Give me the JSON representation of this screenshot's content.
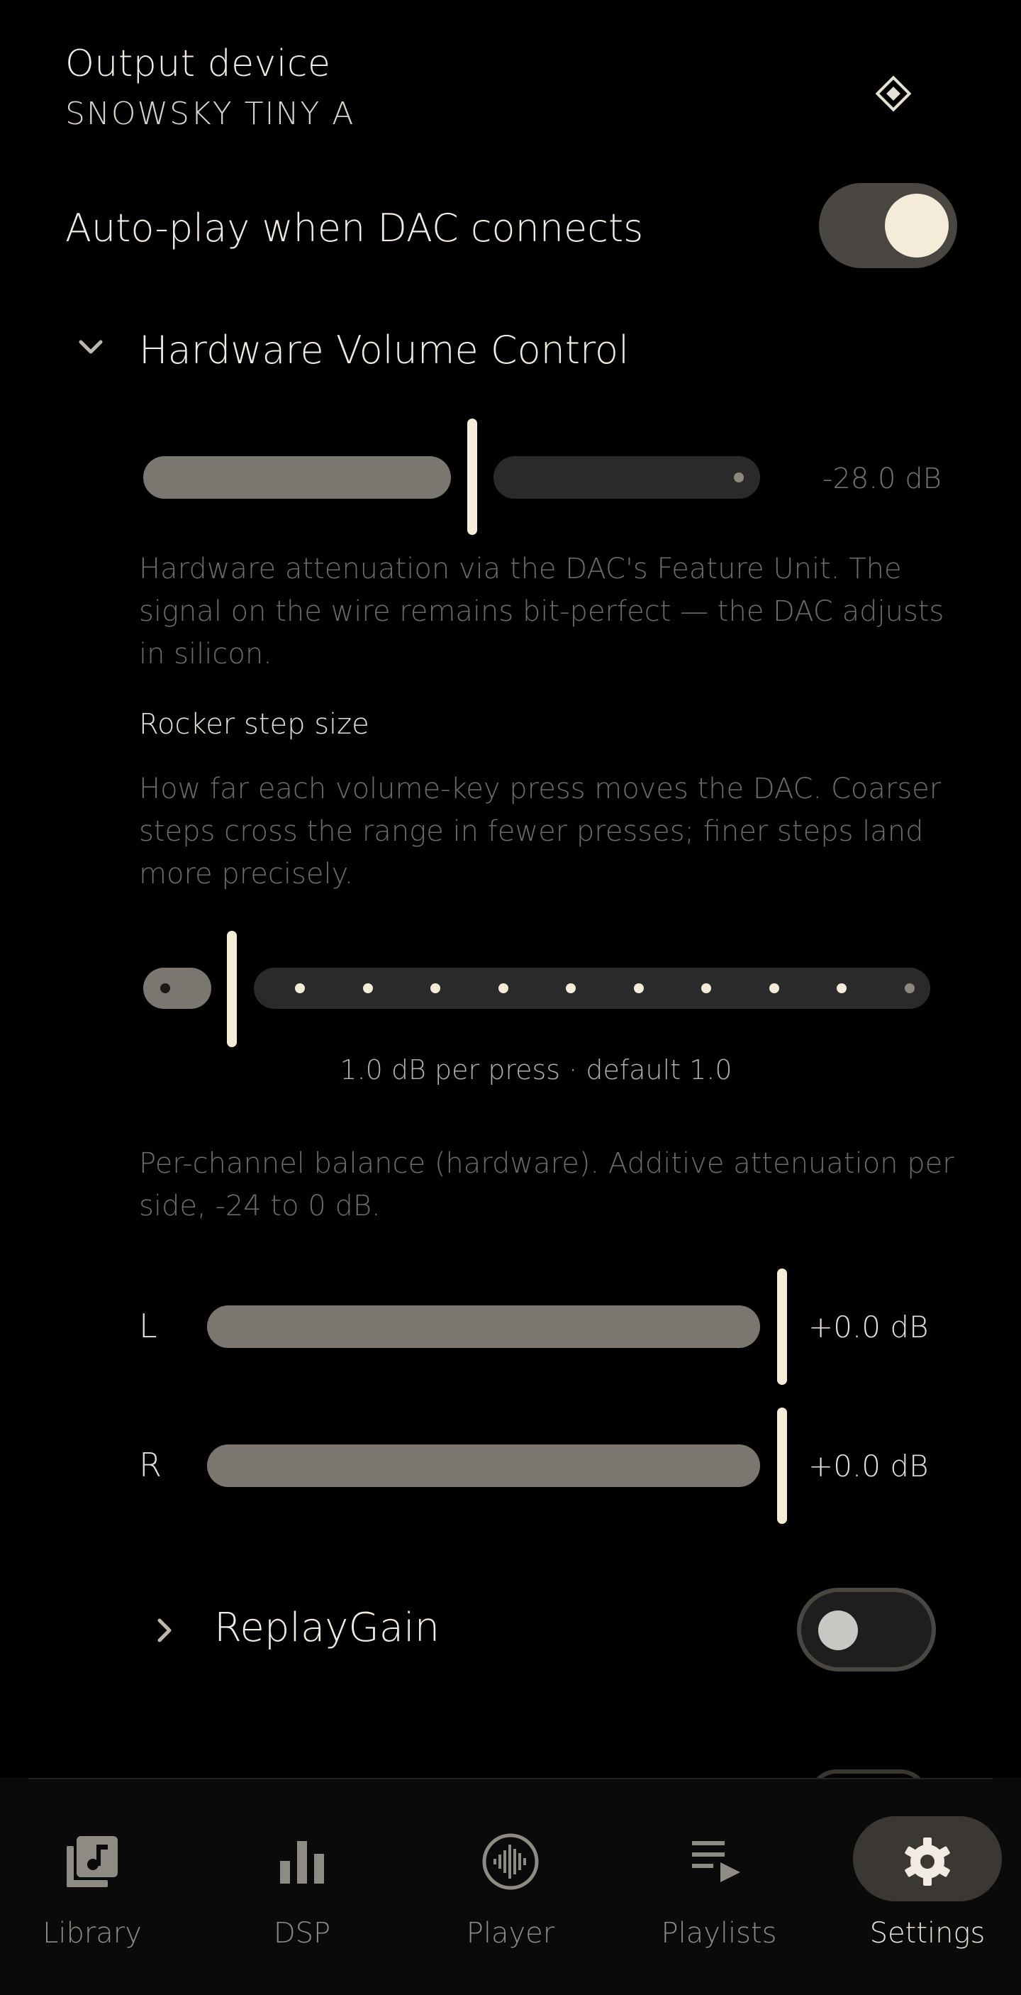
{
  "output_device": {
    "title": "Output device",
    "device_name": "SNOWSKY TINY A",
    "icon": "diamond-icon"
  },
  "auto_play": {
    "label": "Auto-play when DAC connects",
    "enabled": true
  },
  "hardware_volume": {
    "section_title": "Hardware Volume Control",
    "expanded": true,
    "volume_value": "-28.0 dB",
    "volume_fraction": 0.55,
    "description": "Hardware attenuation via the DAC's Feature Unit. The signal on the wire remains bit-perfect — the DAC adjusts in silicon.",
    "rocker_step_label": "Rocker step size",
    "rocker_step_description": "How far each volume-key press moves the DAC. Coarser steps cross the range in fewer presses; finer steps land more precisely.",
    "rocker_step_caption": "1.0 dB per press · default 1.0",
    "rocker_step_index": 0,
    "rocker_step_count": 11,
    "balance_description": "Per-channel balance (hardware). Additive attenuation per side, -24 to 0 dB.",
    "channels": [
      {
        "label": "L",
        "value": "+0.0 dB"
      },
      {
        "label": "R",
        "value": "+0.0 dB"
      }
    ]
  },
  "replay_gain": {
    "label": "ReplayGain",
    "enabled": false
  },
  "nav": {
    "items": [
      {
        "label": "Library",
        "icon": "library-icon"
      },
      {
        "label": "DSP",
        "icon": "bar-chart-icon"
      },
      {
        "label": "Player",
        "icon": "waveform-icon"
      },
      {
        "label": "Playlists",
        "icon": "playlist-play-icon"
      },
      {
        "label": "Settings",
        "icon": "gear-icon"
      }
    ],
    "active": "Settings"
  },
  "colors": {
    "background": "#000000",
    "accent": "#f4ecd9",
    "slider_fill": "#7b766f",
    "slider_track": "#2a2a2a"
  }
}
